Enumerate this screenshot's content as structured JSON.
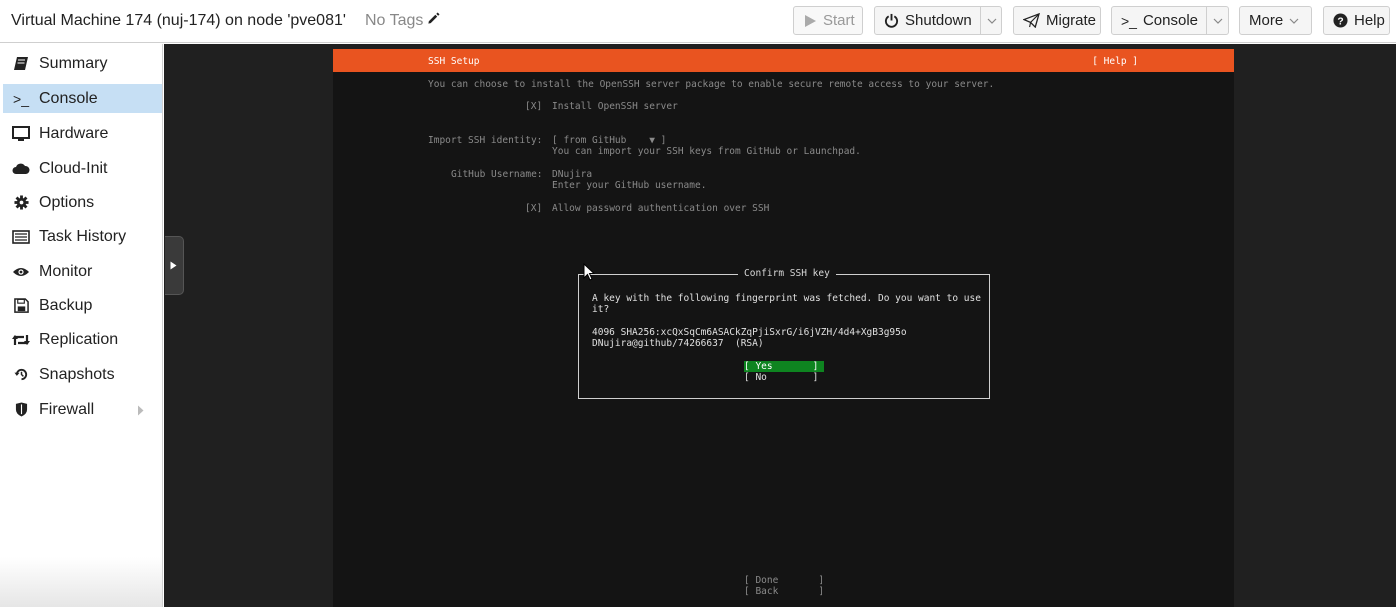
{
  "header": {
    "title": "Virtual Machine 174 (nuj-174) on node 'pve081'",
    "tags": "No Tags",
    "buttons": {
      "start": "Start",
      "shutdown": "Shutdown",
      "migrate": "Migrate",
      "console": "Console",
      "more": "More",
      "help": "Help"
    }
  },
  "sidebar": {
    "items": [
      {
        "label": "Summary",
        "icon": "book-icon"
      },
      {
        "label": "Console",
        "icon": "terminal-icon"
      },
      {
        "label": "Hardware",
        "icon": "monitor-icon"
      },
      {
        "label": "Cloud-Init",
        "icon": "cloud-icon"
      },
      {
        "label": "Options",
        "icon": "gear-icon"
      },
      {
        "label": "Task History",
        "icon": "list-icon"
      },
      {
        "label": "Monitor",
        "icon": "eye-icon"
      },
      {
        "label": "Backup",
        "icon": "floppy-icon"
      },
      {
        "label": "Replication",
        "icon": "retweet-icon"
      },
      {
        "label": "Snapshots",
        "icon": "history-icon"
      },
      {
        "label": "Firewall",
        "icon": "shield-icon"
      }
    ],
    "active": "Console"
  },
  "terminal": {
    "header_title": "SSH Setup",
    "header_help": "[ Help ]",
    "intro": "You can choose to install the OpenSSH server package to enable secure remote access to your server.",
    "install_checkbox": "[X]",
    "install_label": "Install OpenSSH server",
    "import_label": "Import SSH identity:",
    "import_value": "[ from GitHub    ▼ ]",
    "import_hint": "You can import your SSH keys from GitHub or Launchpad.",
    "username_label": "GitHub Username:",
    "username_value": "DNujira",
    "username_hint": "Enter your GitHub username.",
    "password_checkbox": "[X]",
    "password_label": "Allow password authentication over SSH",
    "dialog": {
      "title": "Confirm SSH key",
      "line1": "A key with the following fingerprint was fetched. Do you want to use",
      "line2": "it?",
      "fingerprint1": "4096 SHA256:xcQxSqCm6ASACkZqPjiSxrG/i6jVZH/4d4+XgB3g95o",
      "fingerprint2": "DNujira@github/74266637  (RSA)",
      "yes": "[ Yes       ]",
      "no": "[ No        ]"
    },
    "done": "[ Done       ]",
    "back": "[ Back       ]"
  },
  "colors": {
    "ubuntu_orange": "#e95420",
    "selected_green": "#0e8420",
    "nav_active": "#c6dff4"
  }
}
